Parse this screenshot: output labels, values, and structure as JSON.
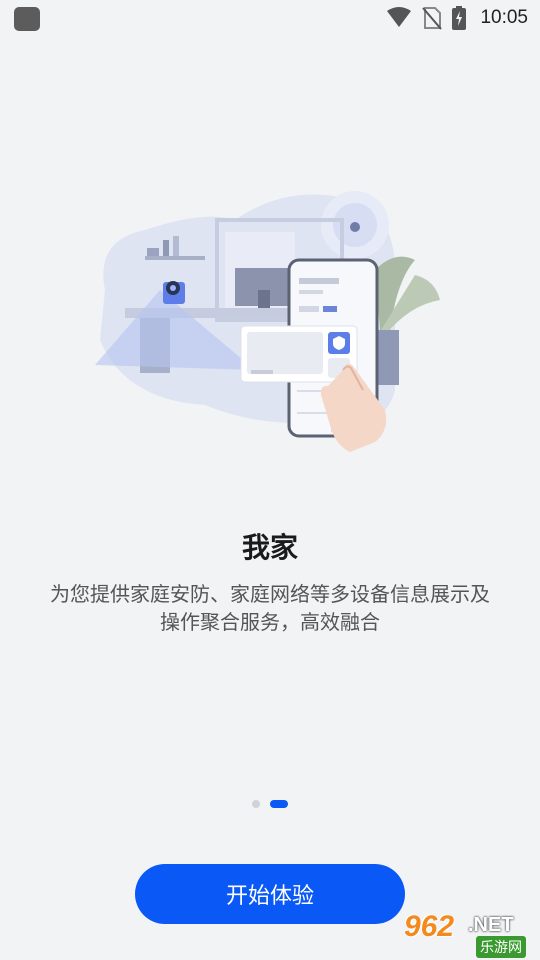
{
  "status_bar": {
    "time": "10:05",
    "icons": [
      "wifi-icon",
      "no-sim-icon",
      "battery-charging-icon"
    ]
  },
  "onboarding": {
    "title": "我家",
    "description_line1": "为您提供家庭安防、家庭网络等多设备信息展示及",
    "description_line2": "操作聚合服务，高效融合",
    "page_indicator": {
      "total": 2,
      "current": 2
    },
    "start_button_label": "开始体验"
  },
  "watermark": {
    "number": "962",
    "suffix": ".NET",
    "chinese": "乐游网"
  },
  "colors": {
    "accent": "#0a59f7",
    "background": "#f1f3f5",
    "watermark_orange": "#f38a1d",
    "watermark_green": "#3a9a2f"
  }
}
